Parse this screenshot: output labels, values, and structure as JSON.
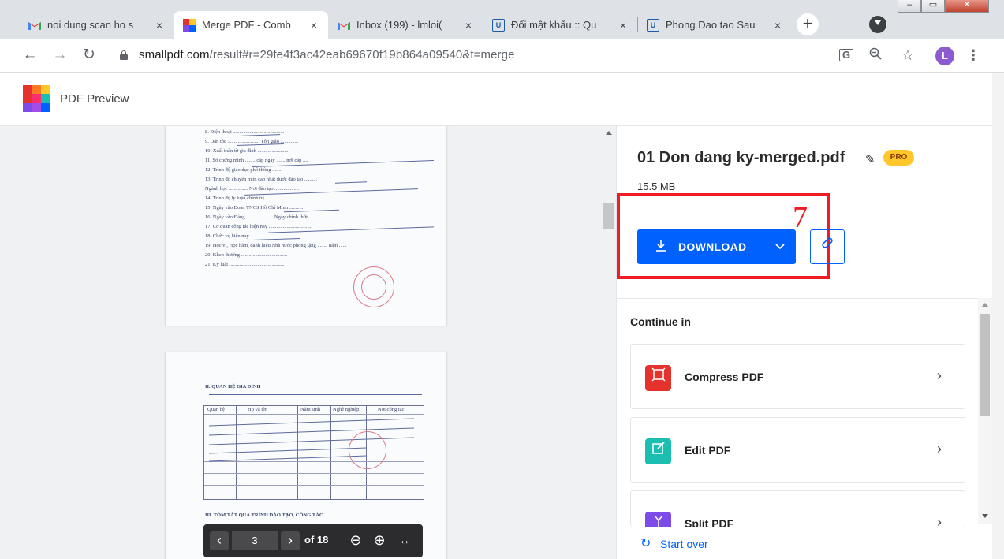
{
  "browser": {
    "tabs": [
      {
        "title": "noi dung scan ho s",
        "favicon": "gmail-icon"
      },
      {
        "title": "Merge PDF - Comb",
        "favicon": "smallpdf-icon",
        "active": true
      },
      {
        "title": "Inbox (199) - lmloi(",
        "favicon": "gmail-icon"
      },
      {
        "title": "Đổi mật khẩu :: Qu",
        "favicon": "uis-icon"
      },
      {
        "title": "Phong Dao tao Sau",
        "favicon": "uis-icon"
      }
    ],
    "tab_close": "×",
    "new_tab": "+",
    "url_domain": "smallpdf.com",
    "url_path": "/result#r=29fe4f3ac42eab69670f19b864a09540&t=merge",
    "profile_initial": "L"
  },
  "app": {
    "title": "PDF Preview"
  },
  "preview": {
    "page1_lines": [
      "8. Điện thoại ........................................",
      "9. Dân tộc ......................... Tôn giáo ..............",
      "10. Xuất thân từ gia đình .........................",
      "11. Số chứng minh ........ cấp ngày ....... nơi cấp ....",
      "12. Trình độ giáo dục phổ thông .......",
      "13. Trình độ chuyên môn cao nhất được đào tạo ..........",
      "    Ngành học ............... Nơi đào tạo ...................",
      "14. Trình độ lý luận chính trị ........",
      "15. Ngày vào Đoàn TNCS Hồ Chí Minh ............",
      "16. Ngày vào Đảng ..................... Ngày chính thức ......",
      "17. Cơ quan công tác hiện nay ..................................",
      "18. Chức vụ hiện nay ...........................",
      "19. Học vị, Học hàm, danh hiệu Nhà nước phong tặng ........ năm ......",
      "20. Khen thưởng ....................................",
      "21. Kỷ luật ..........................................."
    ],
    "page2_heading": "II. QUAN HỆ GIA ĐÌNH",
    "page2_table_headers": [
      "Quan hệ",
      "Họ và tên",
      "Năm sinh",
      "Nghề nghiệp",
      "Nơi công tác"
    ],
    "page2_footer": "III. TÓM TẮT QUÁ TRÌNH ĐÀO TẠO, CÔNG TÁC",
    "pager": {
      "current_page": "3",
      "total": "of 18",
      "prev": "‹",
      "next": "›",
      "zoom_out": "⊖",
      "zoom_in": "⊕",
      "fit": "↔"
    }
  },
  "file": {
    "name": "01 Don dang ky-merged.pdf",
    "badge": "PRO",
    "size": "15.5 MB"
  },
  "actions": {
    "download_label": "DOWNLOAD"
  },
  "annotation": {
    "step_number": "7",
    "highlight_color": "#ee1c24"
  },
  "continue_in": {
    "heading": "Continue in",
    "items": [
      {
        "label": "Compress PDF",
        "color": "#e5322d",
        "icon": "compress-icon"
      },
      {
        "label": "Edit PDF",
        "color": "#1bbfb1",
        "icon": "edit-icon"
      },
      {
        "label": "Split PDF",
        "color": "#7d4ce8",
        "icon": "split-icon"
      }
    ]
  },
  "footer": {
    "start_over": "Start over"
  },
  "colors": {
    "accent": "#0061fe",
    "pro_badge": "#ffc72a"
  }
}
